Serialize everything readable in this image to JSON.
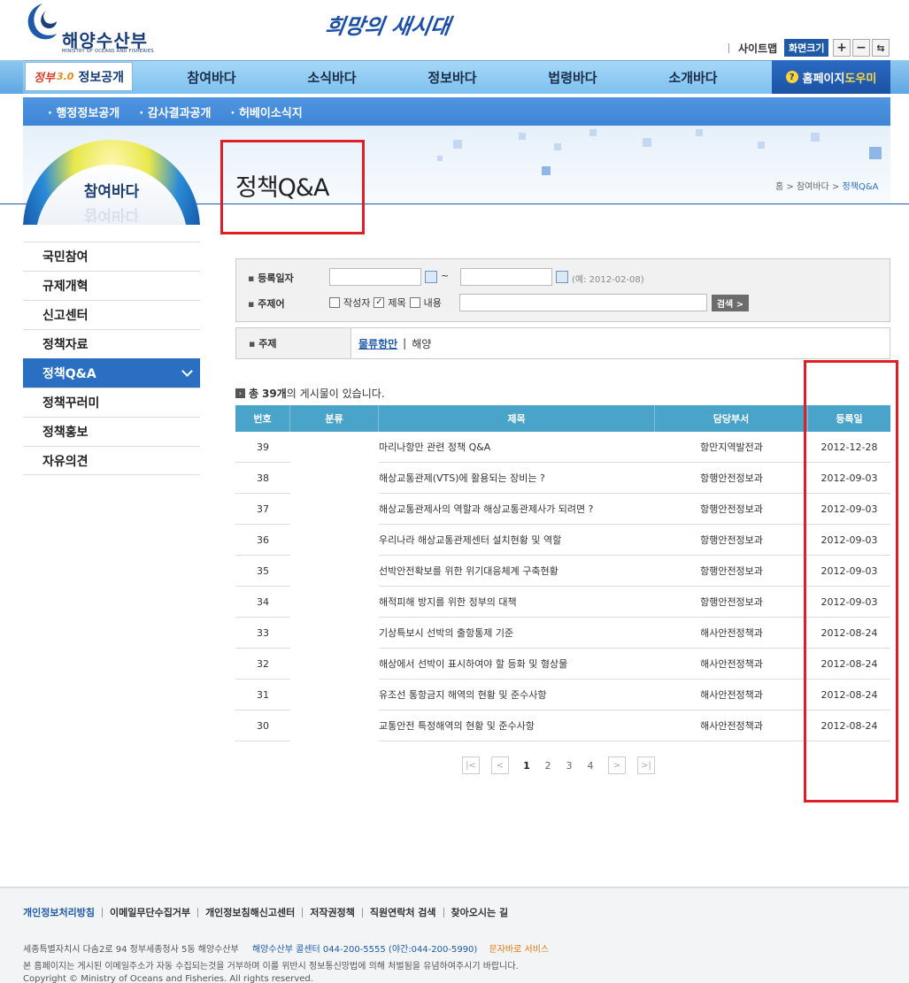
{
  "header": {
    "logo_name": "해양수산부",
    "logo_sub": "MINISTRY OF OCEANS AND FISHERIES",
    "slogan": "희망의 새시대",
    "sitemap": "사이트맵",
    "font_size_label": "화면크기",
    "zoom_in": "+",
    "zoom_out": "−",
    "reset": "⇆"
  },
  "gnb": {
    "brand_a": "정부",
    "brand_b": "3.0",
    "brand_c": "정보공개",
    "items": [
      "참여바다",
      "소식바다",
      "정보바다",
      "법령바다",
      "소개바다"
    ],
    "help_a": "홈페이지",
    "help_b": "도우미",
    "help_icon": "question-icon"
  },
  "subnav": [
    "행정정보공개",
    "감사결과공개",
    "허베이소식지"
  ],
  "sidebar": {
    "title": "참여바다",
    "items": [
      "국민참여",
      "규제개혁",
      "신고센터",
      "정책자료",
      "정책Q&A",
      "정책꾸러미",
      "정책홍보",
      "자유의견"
    ],
    "active_index": 4
  },
  "page": {
    "title": "정책Q&A",
    "breadcrumb": [
      "홈",
      "참여바다",
      "정책Q&A"
    ],
    "breadcrumb_sep": ">"
  },
  "search": {
    "date_label": "등록일자",
    "date_tilde": "~",
    "date_example": "(예: 2012-02-08)",
    "keyword_label": "주제어",
    "opt_author": "작성자",
    "opt_title": "제목",
    "opt_content": "내용",
    "opt_title_checked": true,
    "button": "검색 >"
  },
  "subject": {
    "label": "주제",
    "active": "물류항만",
    "sep": "|",
    "other": "해양"
  },
  "list": {
    "total_prefix": "총",
    "total_count": "39개",
    "total_suffix": "의 게시물이 있습니다.",
    "headers": [
      "번호",
      "분류",
      "제목",
      "담당부서",
      "등록일"
    ],
    "rows": [
      {
        "no": "39",
        "cat": "",
        "title": "마리나항만 관련 정책 Q&A",
        "dept": "항만지역발전과",
        "date": "2012-12-28"
      },
      {
        "no": "38",
        "cat": "",
        "title": "해상교통관제(VTS)에 활용되는 장비는 ?",
        "dept": "항행안전정보과",
        "date": "2012-09-03"
      },
      {
        "no": "37",
        "cat": "",
        "title": "해상교통관제사의 역할과 해상교통관제사가 되려면 ?",
        "dept": "항행안전정보과",
        "date": "2012-09-03"
      },
      {
        "no": "36",
        "cat": "",
        "title": "우리나라 해상교통관제센터 설치현황 및 역할",
        "dept": "항행안전정보과",
        "date": "2012-09-03"
      },
      {
        "no": "35",
        "cat": "",
        "title": "선박안전확보를 위한 위기대응체계 구축현황",
        "dept": "항행안전정보과",
        "date": "2012-09-03"
      },
      {
        "no": "34",
        "cat": "",
        "title": "해적피해 방지를 위한 정부의 대책",
        "dept": "항행안전정보과",
        "date": "2012-09-03"
      },
      {
        "no": "33",
        "cat": "",
        "title": "기상특보시 선박의 출항통제 기준",
        "dept": "해사안전정책과",
        "date": "2012-08-24"
      },
      {
        "no": "32",
        "cat": "",
        "title": "해상에서 선박이 표시하여야 할 등화 및 형상물",
        "dept": "해사안전정책과",
        "date": "2012-08-24"
      },
      {
        "no": "31",
        "cat": "",
        "title": "유조선 통항금지 해역의 현황 및 준수사항",
        "dept": "해사안전정책과",
        "date": "2012-08-24"
      },
      {
        "no": "30",
        "cat": "",
        "title": "교통안전 특정해역의 현황 및 준수사항",
        "dept": "해사안전정책과",
        "date": "2012-08-24"
      }
    ]
  },
  "pager": {
    "first": "|<",
    "prev": "<",
    "pages": [
      "1",
      "2",
      "3",
      "4"
    ],
    "current": "1",
    "next": ">",
    "last": ">|"
  },
  "footer": {
    "links": [
      "개인정보처리방침",
      "이메일무단수집거부",
      "개인정보침해신고센터",
      "저작권정책",
      "직원연락처 검색",
      "찾아오시는 길"
    ],
    "address": "세종특별자치시 다솜2로 94 정부세종청사 5동 해양수산부",
    "callcenter": "해양수산부 콜센터 044-200-5555 (야간:044-200-5990)",
    "service": "문자바로 서비스",
    "notice": "본 홈페이지는 게시된 이메일주소가 자동 수집되는것을 거부하며 이를 위반시 정보통신망법에 의해 처벌됨을 유념하여주시기 바랍니다.",
    "copyright": "Copyright © Ministry of Oceans and Fisheries. All rights reserved."
  },
  "colors": {
    "brand_blue": "#1f5aa8",
    "table_header": "#4aa3c8",
    "highlight_red": "#e01e25"
  }
}
